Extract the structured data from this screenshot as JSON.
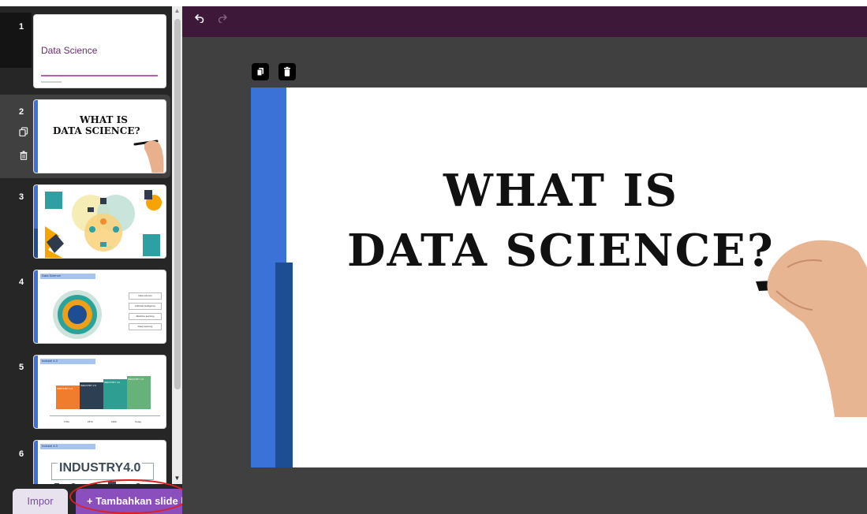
{
  "toolbar": {
    "undo_icon": "undo-icon",
    "redo_icon": "redo-icon"
  },
  "slides": [
    {
      "number": "1",
      "title": "Data Science"
    },
    {
      "number": "2",
      "title_line1": "WHAT IS",
      "title_line2": "DATA SCIENCE?"
    },
    {
      "number": "3"
    },
    {
      "number": "4",
      "header": "Data Science",
      "items": [
        "Data science",
        "Artificial intelligence",
        "Machine learning",
        "Deep learning"
      ]
    },
    {
      "number": "5",
      "header": "Industri 4.0",
      "industries": [
        "INDUSTRY 1.0",
        "INDUSTRY 2.0",
        "INDUSTRY 3.0",
        "INDUSTRY 4.0"
      ],
      "years": [
        "1784",
        "1870",
        "1969",
        "Today"
      ]
    },
    {
      "number": "6",
      "header": "Industri 4.0",
      "title": "INDUSTRY4.0"
    }
  ],
  "buttons": {
    "import": "Impor",
    "add_slide": "+ Tambahkan slide b"
  },
  "canvas": {
    "title_line1": "WHAT IS",
    "title_line2": "DATA SCIENCE?"
  },
  "colors": {
    "toolbar": "#3e1838",
    "accent_purple": "#8a4fbd",
    "slide_blue": "#3a72d8",
    "slide_dark_blue": "#1d4e94",
    "annotation_red": "#e02020"
  }
}
